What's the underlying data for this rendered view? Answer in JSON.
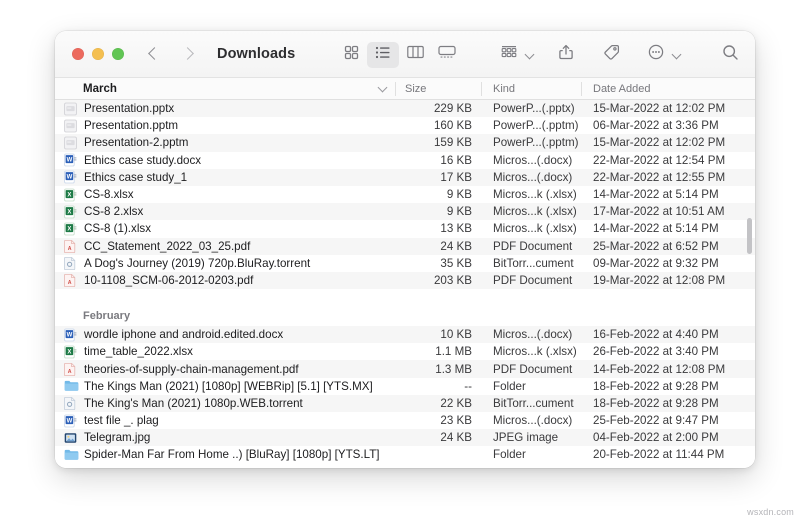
{
  "window": {
    "title": "Downloads",
    "traffic_lights": [
      "close",
      "minimize",
      "zoom"
    ],
    "nav": {
      "back": "back",
      "forward": "forward"
    }
  },
  "toolbar": {
    "view_icon_grid": "icon-view",
    "view_list": "list-view",
    "view_column": "column-view",
    "view_gallery": "gallery-view",
    "group_by": "group-by",
    "share": "share",
    "tags": "tags",
    "more": "more-actions",
    "search": "search"
  },
  "columns": {
    "name": "March",
    "size": "Size",
    "kind": "Kind",
    "date": "Date Added"
  },
  "groups": [
    {
      "label": "March",
      "files": [
        {
          "name": "Presentation.pptx",
          "size": "229 KB",
          "kind": "PowerP...(.pptx)",
          "date": "15-Mar-2022 at 12:02 PM",
          "icon": "powerpoint-file-icon"
        },
        {
          "name": "Presentation.pptm",
          "size": "160 KB",
          "kind": "PowerP...(.pptm)",
          "date": "06-Mar-2022 at 3:36 PM",
          "icon": "powerpoint-file-icon"
        },
        {
          "name": "Presentation-2.pptm",
          "size": "159 KB",
          "kind": "PowerP...(.pptm)",
          "date": "15-Mar-2022 at 12:02 PM",
          "icon": "powerpoint-file-icon"
        },
        {
          "name": "Ethics case study.docx",
          "size": "16 KB",
          "kind": "Micros...(.docx)",
          "date": "22-Mar-2022 at 12:54 PM",
          "icon": "word-file-icon"
        },
        {
          "name": "Ethics case study_1",
          "size": "17 KB",
          "kind": "Micros...(.docx)",
          "date": "22-Mar-2022 at 12:55 PM",
          "icon": "word-file-icon"
        },
        {
          "name": "CS-8.xlsx",
          "size": "9 KB",
          "kind": "Micros...k (.xlsx)",
          "date": "14-Mar-2022 at 5:14 PM",
          "icon": "excel-file-icon"
        },
        {
          "name": "CS-8 2.xlsx",
          "size": "9 KB",
          "kind": "Micros...k (.xlsx)",
          "date": "17-Mar-2022 at 10:51 AM",
          "icon": "excel-file-icon"
        },
        {
          "name": "CS-8 (1).xlsx",
          "size": "13 KB",
          "kind": "Micros...k (.xlsx)",
          "date": "14-Mar-2022 at 5:14 PM",
          "icon": "excel-file-icon"
        },
        {
          "name": "CC_Statement_2022_03_25.pdf",
          "size": "24 KB",
          "kind": "PDF Document",
          "date": "25-Mar-2022 at 6:52 PM",
          "icon": "pdf-file-icon"
        },
        {
          "name": "A Dog's Journey (2019) 720p.BluRay.torrent",
          "size": "35 KB",
          "kind": "BitTorr...cument",
          "date": "09-Mar-2022 at 9:32 PM",
          "icon": "torrent-file-icon"
        },
        {
          "name": "10-1108_SCM-06-2012-0203.pdf",
          "size": "203 KB",
          "kind": "PDF Document",
          "date": "19-Mar-2022 at 12:08 PM",
          "icon": "pdf-file-icon"
        }
      ]
    },
    {
      "label": "February",
      "files": [
        {
          "name": "wordle iphone and android.edited.docx",
          "size": "10 KB",
          "kind": "Micros...(.docx)",
          "date": "16-Feb-2022 at 4:40 PM",
          "icon": "word-file-icon"
        },
        {
          "name": "time_table_2022.xlsx",
          "size": "1.1 MB",
          "kind": "Micros...k (.xlsx)",
          "date": "26-Feb-2022 at 3:40 PM",
          "icon": "excel-file-icon"
        },
        {
          "name": "theories-of-supply-chain-management.pdf",
          "size": "1.3 MB",
          "kind": "PDF Document",
          "date": "14-Feb-2022 at 12:08 PM",
          "icon": "pdf-file-icon"
        },
        {
          "name": "The Kings Man (2021) [1080p] [WEBRip] [5.1] [YTS.MX]",
          "size": "--",
          "kind": "Folder",
          "date": "18-Feb-2022 at 9:28 PM",
          "icon": "folder-icon"
        },
        {
          "name": "The King's Man (2021) 1080p.WEB.torrent",
          "size": "22 KB",
          "kind": "BitTorr...cument",
          "date": "18-Feb-2022 at 9:28 PM",
          "icon": "torrent-file-icon"
        },
        {
          "name": "test file _. plag",
          "size": "23 KB",
          "kind": "Micros...(.docx)",
          "date": "25-Feb-2022 at 9:47 PM",
          "icon": "word-file-icon"
        },
        {
          "name": "Telegram.jpg",
          "size": "24 KB",
          "kind": "JPEG image",
          "date": "04-Feb-2022 at 2:00 PM",
          "icon": "image-file-icon"
        },
        {
          "name": "Spider-Man Far From Home ..) [BluRay] [1080p] [YTS.LT]",
          "size": "",
          "kind": "Folder",
          "date": "20-Feb-2022 at 11:44 PM",
          "icon": "folder-icon"
        }
      ]
    }
  ],
  "watermark": "wsxdn.com"
}
